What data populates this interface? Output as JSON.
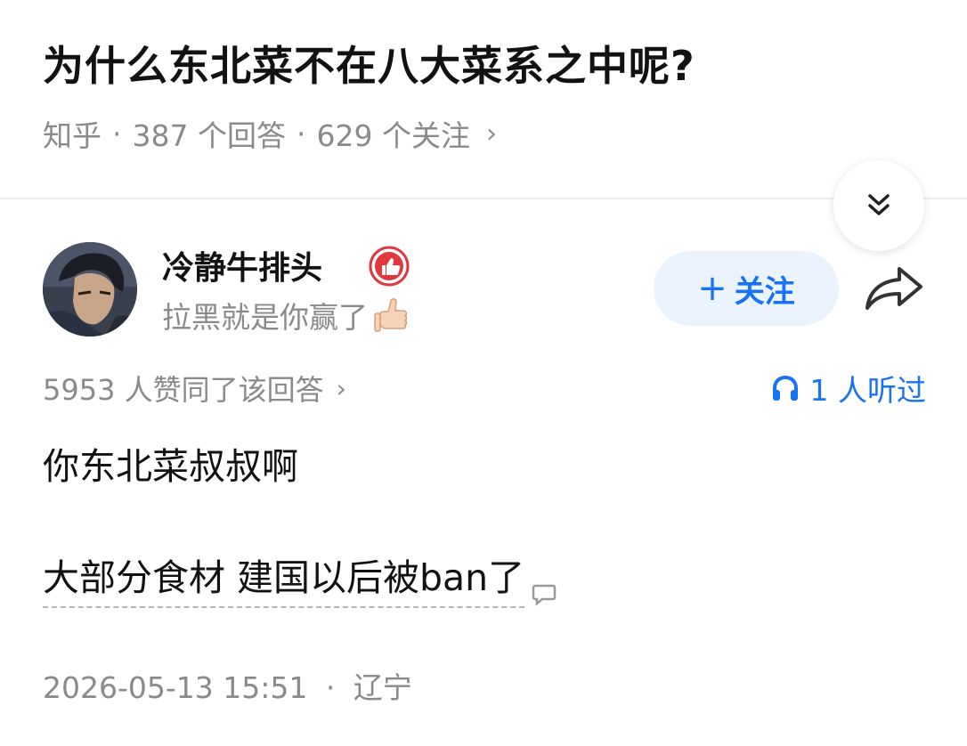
{
  "question": {
    "title": "为什么东北菜不在八大菜系之中呢?",
    "source": "知乎",
    "answers": "387 个回答",
    "followers": "629 个关注",
    "separator": "·",
    "chevron": "›"
  },
  "author": {
    "name": "冷静牛排头",
    "bio": "拉黑就是你赢了",
    "badge_icon": "thumbs-up-badge-icon",
    "avatar_icon": "anime-character-avatar"
  },
  "actions": {
    "follow_plus": "+",
    "follow_label": "关注",
    "share_icon": "share-arrow-icon",
    "collapse_icon": "double-chevron-down-icon"
  },
  "stats": {
    "upvotes": "5953 人赞同了该回答",
    "chevron": "›",
    "listened": "1 人听过",
    "listened_icon": "headphones-icon"
  },
  "answer": {
    "paragraph1": "你东北菜叔叔啊",
    "paragraph2": "大部分食材 建国以后被ban了",
    "comment_icon": "comment-bubble-icon"
  },
  "footer": {
    "datetime": "2026-05-13 15:51",
    "separator": "·",
    "location": "辽宁"
  },
  "colors": {
    "accent": "#1772f6",
    "follow_bg": "#ebf3ff",
    "muted": "#8a8a8a",
    "badge": "#e0383e"
  }
}
